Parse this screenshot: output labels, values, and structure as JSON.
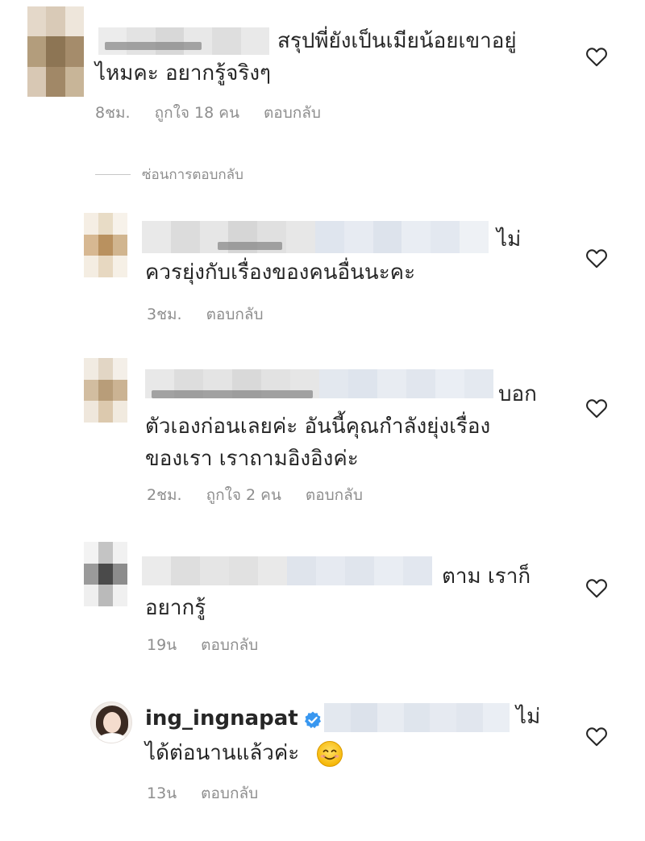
{
  "comments": [
    {
      "text_lines": [
        "สรุปพี่ยังเป็นเมียน้อยเขาอยู่",
        "ไหมคะ อยากรู้จริงๆ"
      ],
      "time": "8ชม.",
      "likes": "ถูกใจ 18 คน",
      "reply": "ตอบกลับ"
    },
    {
      "text_lines": [
        "ไม่",
        "ควรยุ่งกับเรื่องของคนอื่นนะคะ"
      ],
      "time": "3ชม.",
      "reply": "ตอบกลับ"
    },
    {
      "text_lines": [
        "บอก",
        "ตัวเองก่อนเลยค่ะ อันนี้คุณกำลังยุ่งเรื่อง",
        "ของเรา เราถามอิงอิงค่ะ"
      ],
      "time": "2ชม.",
      "likes": "ถูกใจ 2 คน",
      "reply": "ตอบกลับ"
    },
    {
      "text_lines": [
        "ตาม เราก็",
        "อยากรู้"
      ],
      "time": "19น",
      "reply": "ตอบกลับ"
    },
    {
      "username": "ing_ingnapat",
      "text_lines": [
        "ไม่",
        "ได้ต่อนานแล้วค่ะ"
      ],
      "time": "13น",
      "reply": "ตอบกลับ"
    }
  ],
  "hide_replies": "ซ่อนการตอบกลับ",
  "icons": {
    "like": "heart-outline-icon",
    "verified": "verified-badge-icon",
    "emoji": "smiling-face-emoji"
  },
  "colors": {
    "text": "#262626",
    "secondary": "#8e8e8e",
    "verified": "#3897f0"
  }
}
